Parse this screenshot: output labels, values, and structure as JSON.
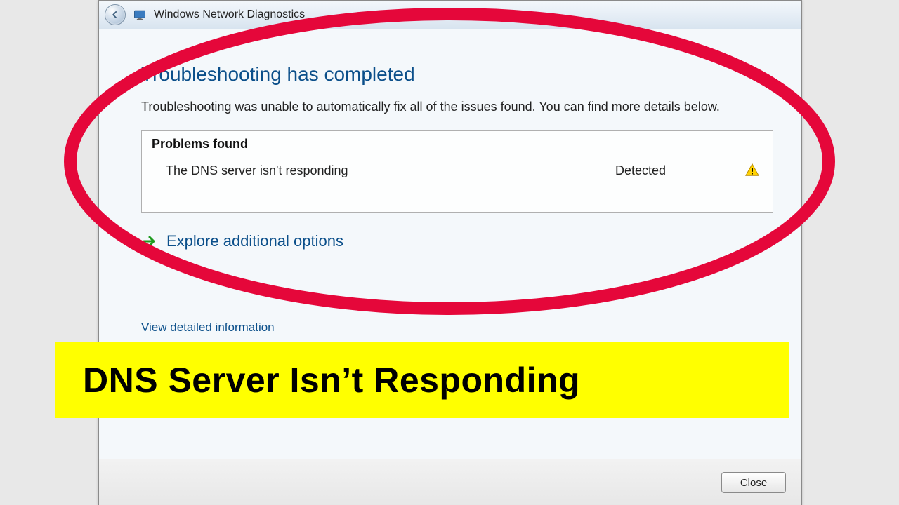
{
  "window": {
    "title": "Windows Network Diagnostics"
  },
  "main": {
    "heading": "Troubleshooting has completed",
    "subtext": "Troubleshooting was unable to automatically fix all of the issues found. You can find more details below.",
    "problems_header": "Problems found",
    "problem": {
      "text": "The DNS server isn't responding",
      "status": "Detected"
    },
    "explore_link": "Explore additional options",
    "detail_link": "View detailed information"
  },
  "footer": {
    "close_label": "Close"
  },
  "overlay": {
    "banner_text": "DNS Server Isn’t Responding"
  }
}
